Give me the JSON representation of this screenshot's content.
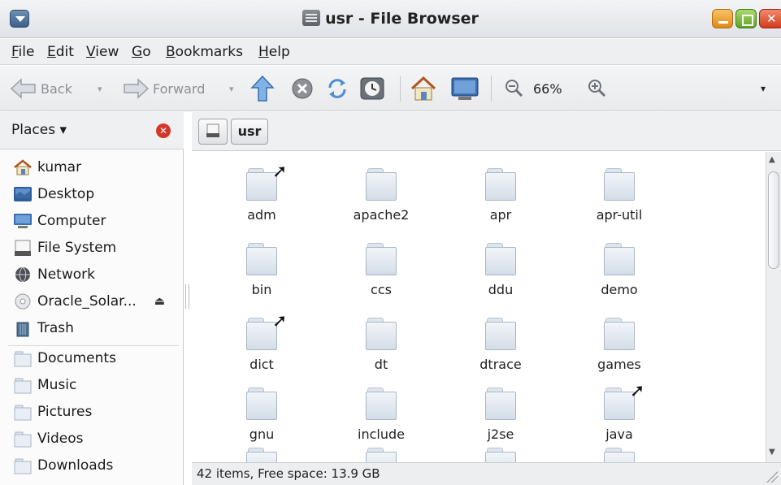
{
  "window": {
    "title": "usr - File Browser"
  },
  "menubar": [
    {
      "label": "File",
      "acc": "F",
      "rest": "ile"
    },
    {
      "label": "Edit",
      "acc": "E",
      "rest": "dit"
    },
    {
      "label": "View",
      "acc": "V",
      "rest": "iew"
    },
    {
      "label": "Go",
      "acc": "G",
      "rest": "o"
    },
    {
      "label": "Bookmarks",
      "acc": "B",
      "rest": "ookmarks"
    },
    {
      "label": "Help",
      "acc": "H",
      "rest": "elp"
    }
  ],
  "toolbar": {
    "back_label": "Back",
    "forward_label": "Forward",
    "zoom_level": "66%",
    "icons": [
      "back-arrow",
      "forward-arrow",
      "up-arrow",
      "stop",
      "reload",
      "history",
      "home",
      "computer",
      "zoom-out",
      "zoom-in",
      "overflow-menu"
    ]
  },
  "sidebar": {
    "header": "Places ▾",
    "places": [
      {
        "label": "kumar",
        "icon": "home-icon"
      },
      {
        "label": "Desktop",
        "icon": "desktop-icon"
      },
      {
        "label": "Computer",
        "icon": "computer-icon"
      },
      {
        "label": "File System",
        "icon": "harddisk-icon"
      },
      {
        "label": "Network",
        "icon": "network-icon"
      },
      {
        "label": "Oracle_Solar...",
        "icon": "cdrom-icon",
        "eject": "⏏"
      },
      {
        "label": "Trash",
        "icon": "trash-icon"
      }
    ],
    "bookmarks": [
      {
        "label": "Documents"
      },
      {
        "label": "Music"
      },
      {
        "label": "Pictures"
      },
      {
        "label": "Videos"
      },
      {
        "label": "Downloads"
      }
    ]
  },
  "pathbar": {
    "current": "usr"
  },
  "files": [
    {
      "name": "adm",
      "link": true
    },
    {
      "name": "apache2",
      "link": false
    },
    {
      "name": "apr",
      "link": false
    },
    {
      "name": "apr-util",
      "link": false
    },
    {
      "name": "bin",
      "link": false
    },
    {
      "name": "ccs",
      "link": false
    },
    {
      "name": "ddu",
      "link": false
    },
    {
      "name": "demo",
      "link": false
    },
    {
      "name": "dict",
      "link": true
    },
    {
      "name": "dt",
      "link": false
    },
    {
      "name": "dtrace",
      "link": false
    },
    {
      "name": "games",
      "link": false
    },
    {
      "name": "gnu",
      "link": false
    },
    {
      "name": "include",
      "link": false
    },
    {
      "name": "j2se",
      "link": false
    },
    {
      "name": "java",
      "link": true
    }
  ],
  "status": "42 items, Free space: 13.9 GB"
}
